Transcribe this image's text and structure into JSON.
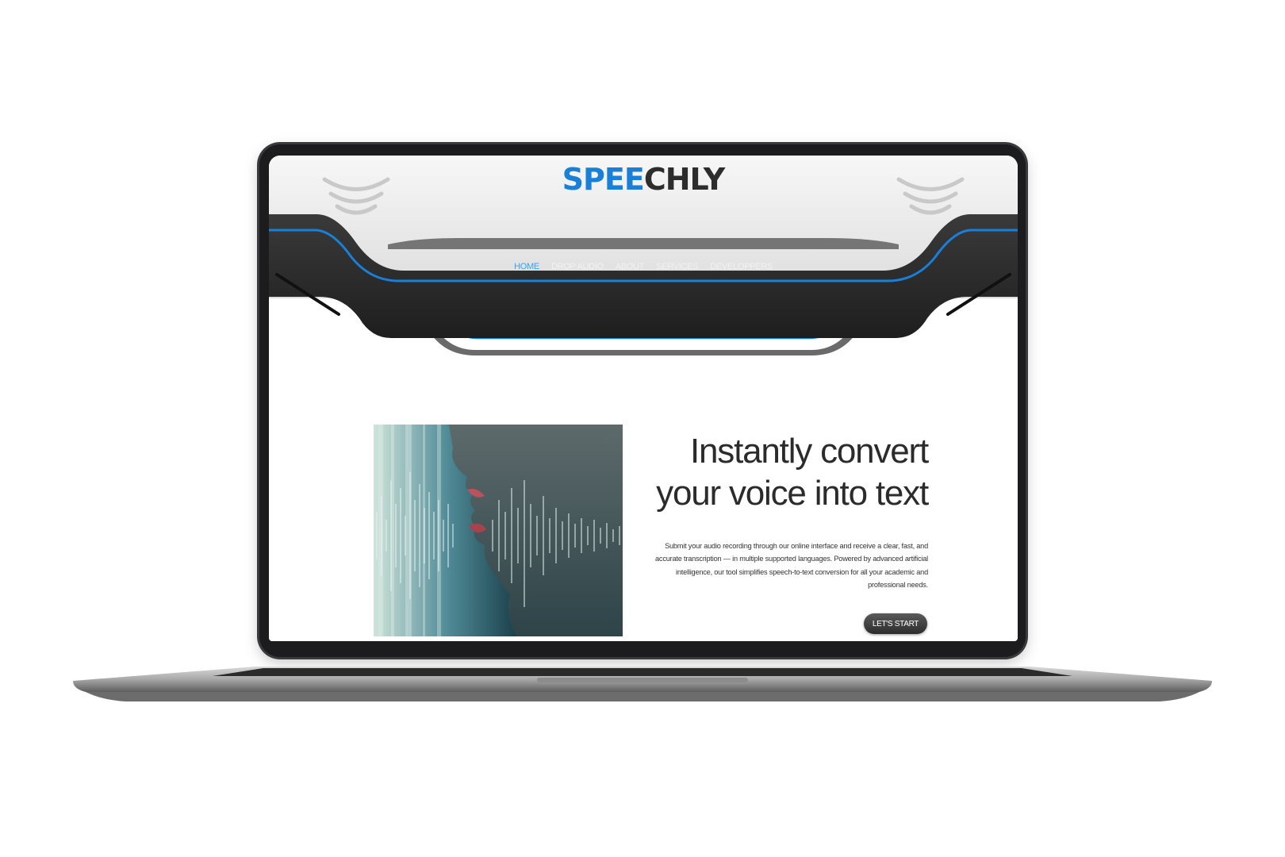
{
  "brand": {
    "part1": "SPEE",
    "part2": "CHLY",
    "accent": "#1a7fd6"
  },
  "nav": {
    "items": [
      "HOME",
      "DROP AUDIO",
      "ABOUT",
      "SERVICES",
      "DEVELOPPERS"
    ],
    "active": "HOME"
  },
  "hero": {
    "title": "Instantly convert\nyour voice into text",
    "description": "Submit your audio recording through our online interface and receive a clear, fast, and accurate transcription — in multiple supported languages. Powered by advanced artificial intelligence, our tool simplifies speech-to-text conversion for all your academic and professional needs.",
    "cta": "LET'S START",
    "image_icon": "voice-waveform-image"
  },
  "colors": {
    "nav_bar": "#2a2a2a",
    "accent_line": "#1a7fd6",
    "header_bg": "#f0f0f0"
  }
}
